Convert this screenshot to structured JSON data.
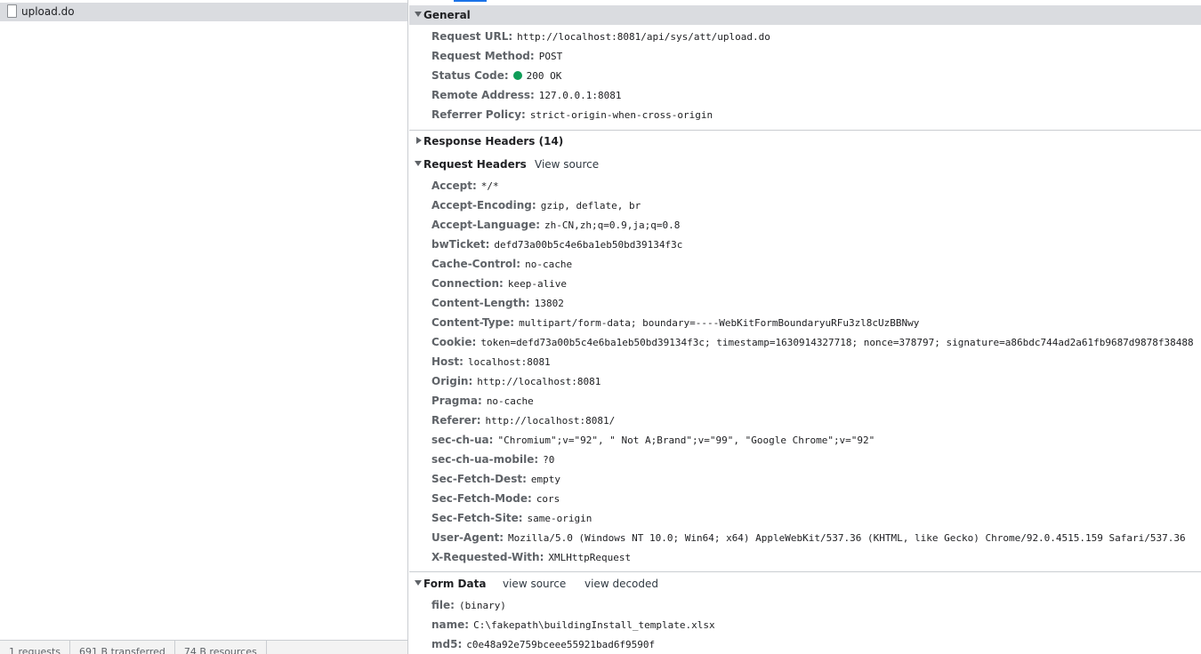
{
  "request_list": {
    "items": [
      {
        "name": "upload.do"
      }
    ],
    "status": {
      "requests": "1 requests",
      "transferred": "691 B transferred",
      "resources": "74 B resources"
    }
  },
  "general": {
    "title": "General",
    "rows": [
      {
        "key": "Request URL:",
        "value": "http://localhost:8081/api/sys/att/upload.do"
      },
      {
        "key": "Request Method:",
        "value": "POST"
      },
      {
        "key": "Status Code:",
        "value": "200 OK"
      },
      {
        "key": "Remote Address:",
        "value": "127.0.0.1:8081"
      },
      {
        "key": "Referrer Policy:",
        "value": "strict-origin-when-cross-origin"
      }
    ]
  },
  "response_headers": {
    "title": "Response Headers (14)"
  },
  "request_headers": {
    "title": "Request Headers",
    "view_source": "View source",
    "rows": [
      {
        "key": "Accept:",
        "value": "*/*"
      },
      {
        "key": "Accept-Encoding:",
        "value": "gzip, deflate, br"
      },
      {
        "key": "Accept-Language:",
        "value": "zh-CN,zh;q=0.9,ja;q=0.8"
      },
      {
        "key": "bwTicket:",
        "value": "defd73a00b5c4e6ba1eb50bd39134f3c"
      },
      {
        "key": "Cache-Control:",
        "value": "no-cache"
      },
      {
        "key": "Connection:",
        "value": "keep-alive"
      },
      {
        "key": "Content-Length:",
        "value": "13802"
      },
      {
        "key": "Content-Type:",
        "value": "multipart/form-data; boundary=----WebKitFormBoundaryuRFu3zl8cUzBBNwy"
      },
      {
        "key": "Cookie:",
        "value": "token=defd73a00b5c4e6ba1eb50bd39134f3c; timestamp=1630914327718; nonce=378797; signature=a86bdc744ad2a61fb9687d9878f38488"
      },
      {
        "key": "Host:",
        "value": "localhost:8081"
      },
      {
        "key": "Origin:",
        "value": "http://localhost:8081"
      },
      {
        "key": "Pragma:",
        "value": "no-cache"
      },
      {
        "key": "Referer:",
        "value": "http://localhost:8081/"
      },
      {
        "key": "sec-ch-ua:",
        "value": "\"Chromium\";v=\"92\", \" Not A;Brand\";v=\"99\", \"Google Chrome\";v=\"92\""
      },
      {
        "key": "sec-ch-ua-mobile:",
        "value": "?0"
      },
      {
        "key": "Sec-Fetch-Dest:",
        "value": "empty"
      },
      {
        "key": "Sec-Fetch-Mode:",
        "value": "cors"
      },
      {
        "key": "Sec-Fetch-Site:",
        "value": "same-origin"
      },
      {
        "key": "User-Agent:",
        "value": "Mozilla/5.0 (Windows NT 10.0; Win64; x64) AppleWebKit/537.36 (KHTML, like Gecko) Chrome/92.0.4515.159 Safari/537.36"
      },
      {
        "key": "X-Requested-With:",
        "value": "XMLHttpRequest"
      }
    ]
  },
  "form_data": {
    "title": "Form Data",
    "view_source": "view source",
    "view_decoded": "view decoded",
    "rows": [
      {
        "key": "file:",
        "value": "(binary)"
      },
      {
        "key": "name:",
        "value": "C:\\fakepath\\buildingInstall_template.xlsx"
      },
      {
        "key": "md5:",
        "value": "c0e48a92e759bceee55921bad6f9590f"
      }
    ]
  },
  "colors": {
    "status_dot": "#0f9d58",
    "tab_accent": "#1a73e8",
    "selected_row": "#dadce0"
  }
}
